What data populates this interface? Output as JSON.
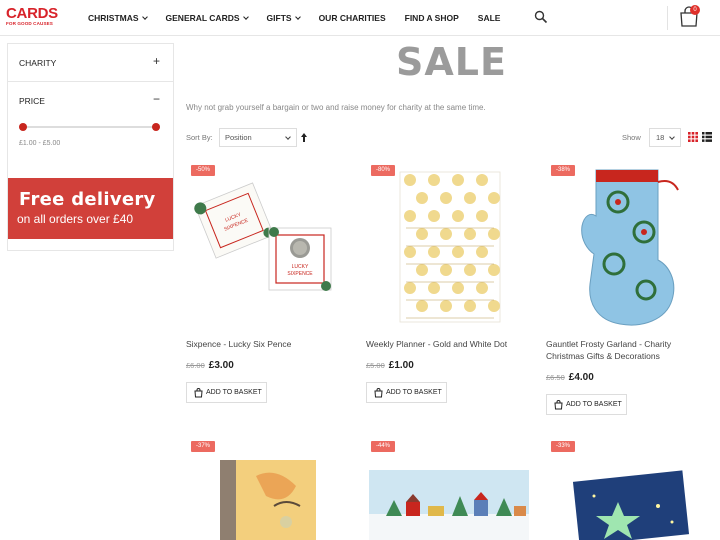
{
  "header": {
    "logo_main": "CARDS",
    "logo_sub": "FOR GOOD CAUSES",
    "nav": [
      "CHRISTMAS",
      "GENERAL CARDS",
      "GIFTS",
      "OUR CHARITIES",
      "FIND A SHOP",
      "SALE"
    ],
    "cart_count": "0"
  },
  "sidebar": {
    "filters": [
      {
        "label": "CHARITY",
        "toggle": "+"
      },
      {
        "label": "PRICE",
        "toggle": "−"
      }
    ],
    "price_range": "£1.00 - £5.00",
    "banner_line1": "Free delivery",
    "banner_line2": "on all orders over £40"
  },
  "main": {
    "title": "SALE",
    "intro": "Why not grab yourself a bargain or two and raise money for charity at the same time.",
    "sort_label": "Sort By:",
    "sort_value": "Position",
    "show_label": "Show",
    "show_value": "18"
  },
  "products": [
    {
      "name": "Sixpence - Lucky Six Pence",
      "badge": "-50%",
      "old_price": "£6.00",
      "price": "£3.00",
      "button": "ADD TO BASKET"
    },
    {
      "name": "Weekly Planner - Gold and White Dot",
      "badge": "-80%",
      "old_price": "£5.00",
      "price": "£1.00",
      "button": "ADD TO BASKET"
    },
    {
      "name": "Gauntlet Frosty Garland - Charity Christmas Gifts & Decorations",
      "badge": "-38%",
      "old_price": "£6.50",
      "price": "£4.00",
      "button": "ADD TO BASKET"
    },
    {
      "badge": "-37%"
    },
    {
      "badge": "-44%"
    },
    {
      "badge": "-33%"
    }
  ]
}
